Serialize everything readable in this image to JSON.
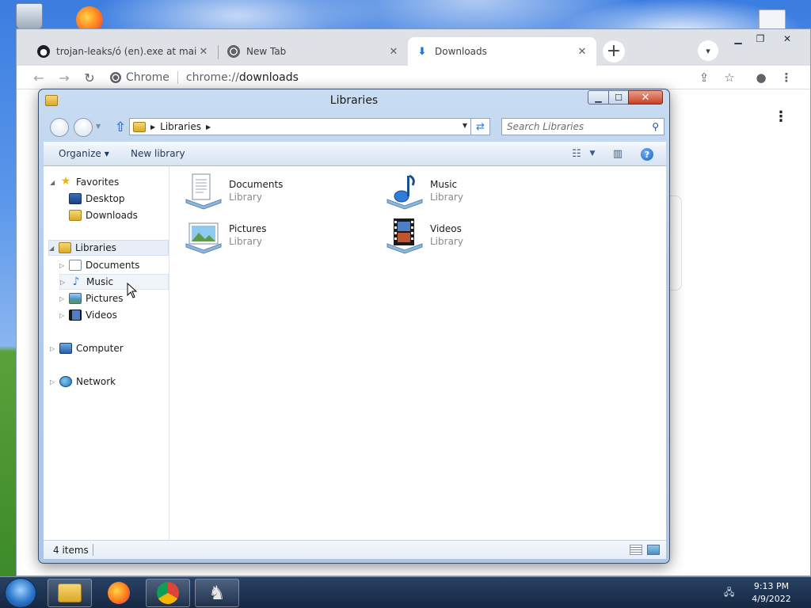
{
  "chrome": {
    "tabs": [
      {
        "title": "trojan-leaks/ó (en).exe at main · j",
        "icon": "github-icon"
      },
      {
        "title": "New Tab",
        "icon": "chrome-icon"
      },
      {
        "title": "Downloads",
        "icon": "download-icon"
      }
    ],
    "omnibox": {
      "site_chip": "Chrome",
      "url_prefix": "chrome://",
      "url_rest": "downloads"
    }
  },
  "explorer": {
    "title": "Libraries",
    "breadcrumb": [
      "Libraries"
    ],
    "search_placeholder": "Search Libraries",
    "commands": {
      "organize": "Organize",
      "new_library": "New library"
    },
    "nav": {
      "favorites": {
        "label": "Favorites",
        "items": [
          "Desktop",
          "Downloads"
        ]
      },
      "libraries": {
        "label": "Libraries",
        "items": [
          "Documents",
          "Music",
          "Pictures",
          "Videos"
        ]
      },
      "computer": "Computer",
      "network": "Network"
    },
    "libraries": [
      {
        "name": "Documents",
        "type": "Library",
        "icon": "documents-library-icon"
      },
      {
        "name": "Music",
        "type": "Library",
        "icon": "music-library-icon"
      },
      {
        "name": "Pictures",
        "type": "Library",
        "icon": "pictures-library-icon"
      },
      {
        "name": "Videos",
        "type": "Library",
        "icon": "videos-library-icon"
      }
    ],
    "status": "4 items"
  },
  "taskbar": {
    "apps": [
      "windows-explorer-icon",
      "firefox-icon",
      "chrome-icon",
      "chess-icon"
    ],
    "clock": {
      "time": "9:13 PM",
      "date": "4/9/2022"
    }
  },
  "colors": {
    "explorer_frame": "#b4cbe8",
    "chrome_tabstrip": "#dee1e6",
    "taskbar": "#1e3450",
    "link_blue": "#1e395b"
  }
}
